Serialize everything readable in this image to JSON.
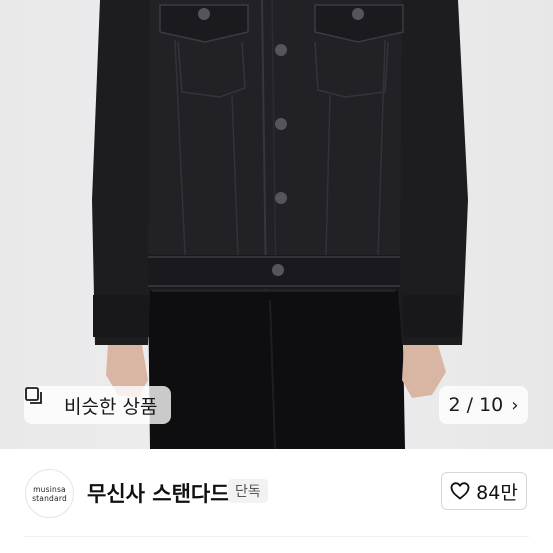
{
  "product_image": {
    "alt_subject": "black denim trucker jacket",
    "similar_button": {
      "label": "비슷한 상품",
      "icon": "copy-squares-icon"
    },
    "pager": {
      "text": "2 / 10",
      "icon": "chevron-right-icon"
    }
  },
  "brand": {
    "logo_line1": "musinsa",
    "logo_line2": "standard",
    "name": "무신사 스탠다드",
    "badge": "단독"
  },
  "like": {
    "count": "84만",
    "icon": "heart-outline-icon"
  },
  "colors": {
    "jacket": "#1c1c1f",
    "background": "#ebebec",
    "pants": "#0d0d10"
  }
}
